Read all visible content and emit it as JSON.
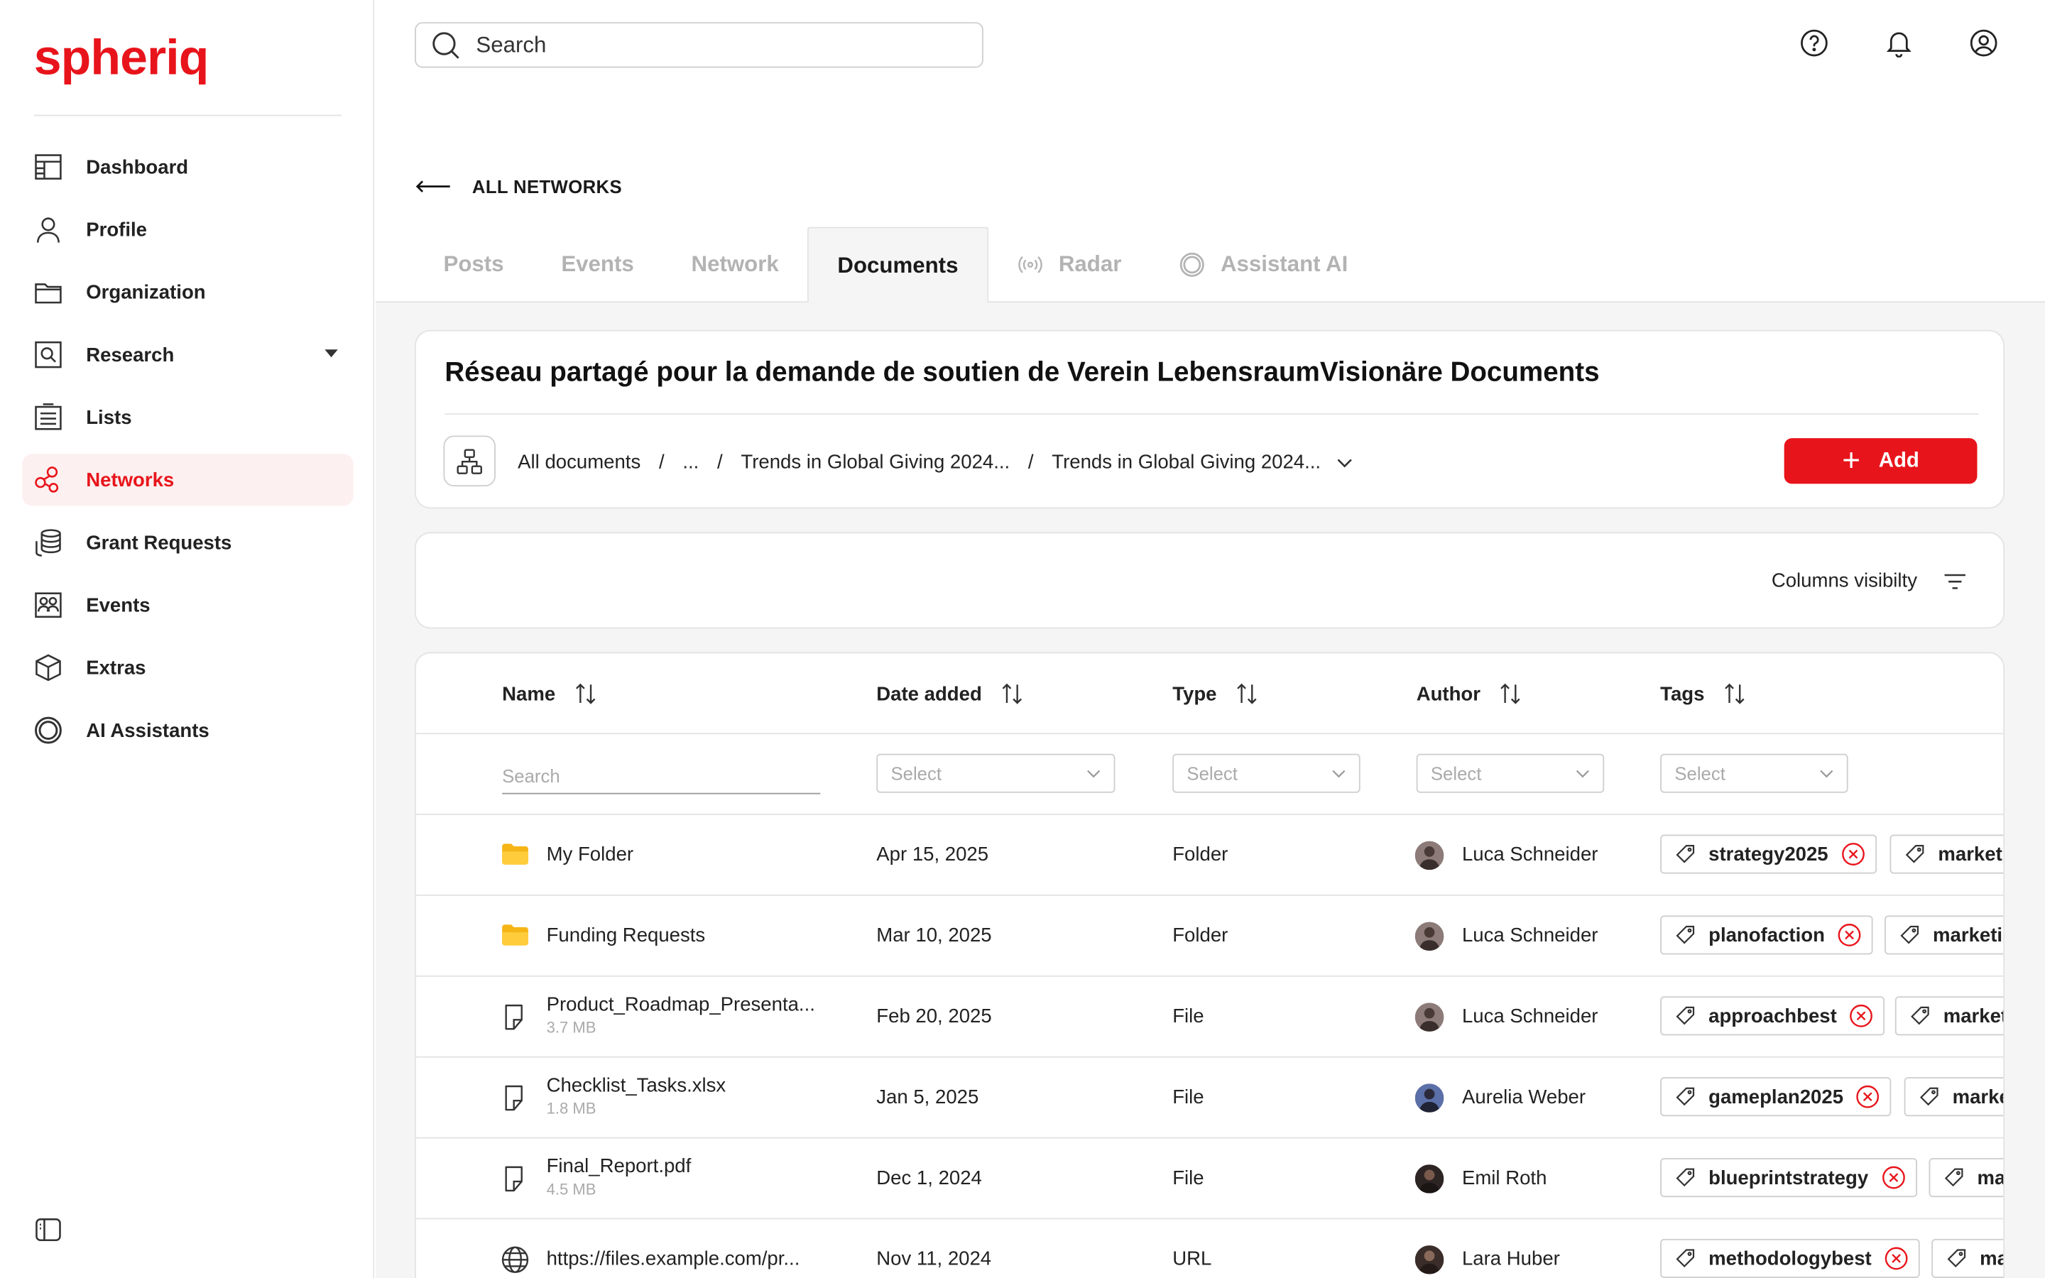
{
  "app": {
    "logo": "spheriq"
  },
  "sidebar": {
    "items": [
      {
        "label": "Dashboard",
        "icon": "dashboard-icon"
      },
      {
        "label": "Profile",
        "icon": "user-icon"
      },
      {
        "label": "Organization",
        "icon": "folder-icon"
      },
      {
        "label": "Research",
        "icon": "search-doc-icon"
      },
      {
        "label": "Lists",
        "icon": "list-icon"
      },
      {
        "label": "Networks",
        "icon": "network-icon",
        "active": true
      },
      {
        "label": "Grant Requests",
        "icon": "coins-icon"
      },
      {
        "label": "Events",
        "icon": "people-icon"
      },
      {
        "label": "Extras",
        "icon": "box-icon"
      },
      {
        "label": "AI Assistants",
        "icon": "ring-icon"
      }
    ]
  },
  "header": {
    "search_placeholder": "Search"
  },
  "back": {
    "label": "ALL NETWORKS"
  },
  "tabs": [
    "Posts",
    "Events",
    "Network",
    "Documents",
    "Radar",
    "Assistant AI"
  ],
  "active_tab": "Documents",
  "documents": {
    "title": "Réseau partagé pour la demande de soutien de Verein LebensraumVisionäre Documents",
    "breadcrumb": [
      "All documents",
      "...",
      "Trends in Global Giving 2024...",
      "Trends in Global Giving 2024..."
    ],
    "add_label": "Add",
    "columns_visibility": "Columns visibilty"
  },
  "table": {
    "columns": [
      "Name",
      "Date added",
      "Type",
      "Author",
      "Tags"
    ],
    "filters": {
      "name_placeholder": "Search",
      "select_placeholder": "Select"
    },
    "rows": [
      {
        "name": "My Folder",
        "size": "",
        "date": "Apr 15, 2025",
        "type": "Folder",
        "author": "Luca Schneider",
        "tag1": "strategy2025",
        "tag2": "marketi"
      },
      {
        "name": "Funding Requests",
        "size": "",
        "date": "Mar 10, 2025",
        "type": "Folder",
        "author": "Luca Schneider",
        "tag1": "planofaction",
        "tag2": "marketin"
      },
      {
        "name": "Product_Roadmap_Presenta...",
        "size": "3.7 MB",
        "date": "Feb 20, 2025",
        "type": "File",
        "author": "Luca Schneider",
        "tag1": "approachbest",
        "tag2": "market"
      },
      {
        "name": "Checklist_Tasks.xlsx",
        "size": "1.8 MB",
        "date": "Jan 5, 2025",
        "type": "File",
        "author": "Aurelia Weber",
        "tag1": "gameplan2025",
        "tag2": "marke"
      },
      {
        "name": "Final_Report.pdf",
        "size": "4.5 MB",
        "date": "Dec 1, 2024",
        "type": "File",
        "author": "Emil Roth",
        "tag1": "blueprintstrategy",
        "tag2": "ma"
      },
      {
        "name": "https://files.example.com/pr...",
        "size": "",
        "date": "Nov 11, 2024",
        "type": "URL",
        "author": "Lara Huber",
        "tag1": "methodologybest",
        "tag2": "ma"
      }
    ]
  },
  "colors": {
    "accent": "#e8141b",
    "folder": "#f5b516"
  }
}
